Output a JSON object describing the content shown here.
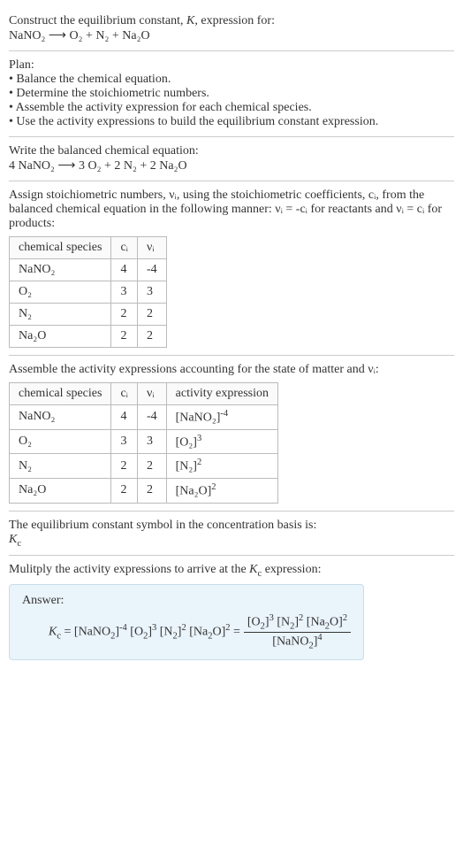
{
  "intro": {
    "prompt_line1": "Construct the equilibrium constant, K, expression for:",
    "equation_unbalanced": "NaNO₂ ⟶ O₂ + N₂ + Na₂O"
  },
  "plan": {
    "heading": "Plan:",
    "items": [
      "• Balance the chemical equation.",
      "• Determine the stoichiometric numbers.",
      "• Assemble the activity expression for each chemical species.",
      "• Use the activity expressions to build the equilibrium constant expression."
    ]
  },
  "balanced": {
    "heading": "Write the balanced chemical equation:",
    "equation": "4 NaNO₂ ⟶ 3 O₂ + 2 N₂ + 2 Na₂O"
  },
  "stoich": {
    "text": "Assign stoichiometric numbers, νᵢ, using the stoichiometric coefficients, cᵢ, from the balanced chemical equation in the following manner: νᵢ = -cᵢ for reactants and νᵢ = cᵢ for products:",
    "headers": {
      "species": "chemical species",
      "ci": "cᵢ",
      "vi": "νᵢ"
    },
    "rows": [
      {
        "species": "NaNO₂",
        "ci": "4",
        "vi": "-4"
      },
      {
        "species": "O₂",
        "ci": "3",
        "vi": "3"
      },
      {
        "species": "N₂",
        "ci": "2",
        "vi": "2"
      },
      {
        "species": "Na₂O",
        "ci": "2",
        "vi": "2"
      }
    ]
  },
  "activity": {
    "text": "Assemble the activity expressions accounting for the state of matter and νᵢ:",
    "headers": {
      "species": "chemical species",
      "ci": "cᵢ",
      "vi": "νᵢ",
      "expr": "activity expression"
    },
    "rows": [
      {
        "species": "NaNO₂",
        "ci": "4",
        "vi": "-4",
        "expr_base": "[NaNO₂]",
        "expr_pow": "-4"
      },
      {
        "species": "O₂",
        "ci": "3",
        "vi": "3",
        "expr_base": "[O₂]",
        "expr_pow": "3"
      },
      {
        "species": "N₂",
        "ci": "2",
        "vi": "2",
        "expr_base": "[N₂]",
        "expr_pow": "2"
      },
      {
        "species": "Na₂O",
        "ci": "2",
        "vi": "2",
        "expr_base": "[Na₂O]",
        "expr_pow": "2"
      }
    ]
  },
  "kc_symbol": {
    "text": "The equilibrium constant symbol in the concentration basis is:",
    "symbol": "K꜀"
  },
  "final": {
    "text": "Mulitply the activity expressions to arrive at the K꜀ expression:",
    "answer_label": "Answer:",
    "lhs": "K꜀ = [NaNO₂]⁻⁴ [O₂]³ [N₂]² [Na₂O]² = ",
    "num": "[O₂]³ [N₂]² [Na₂O]²",
    "den": "[NaNO₂]⁴"
  }
}
